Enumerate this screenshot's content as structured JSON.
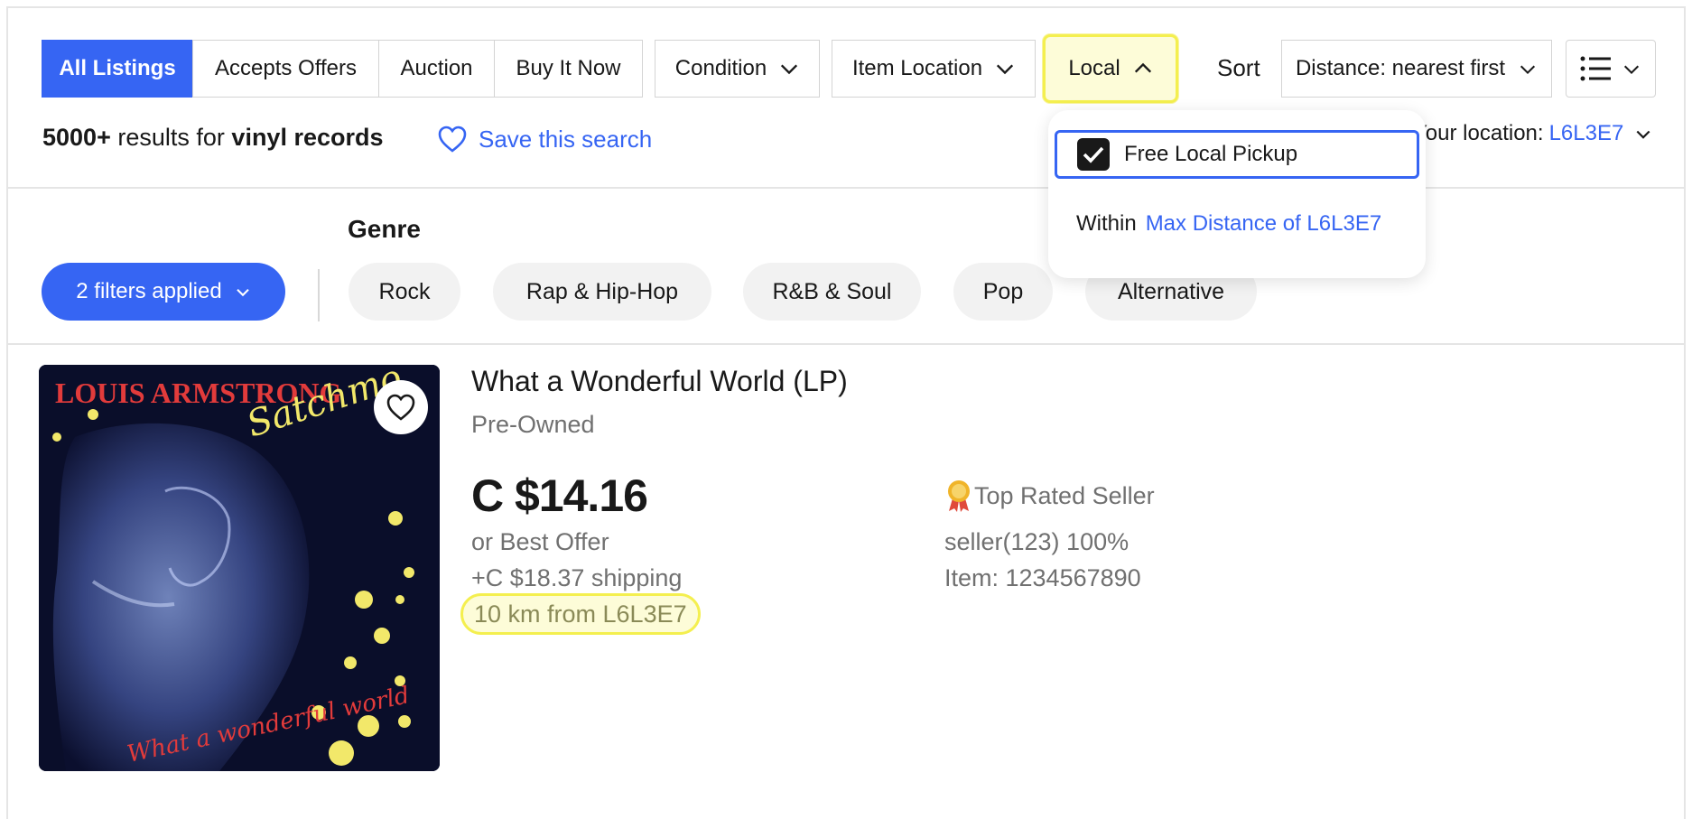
{
  "filter_bar": {
    "segments": [
      "All Listings",
      "Accepts Offers",
      "Auction",
      "Buy It Now"
    ],
    "condition_label": "Condition",
    "item_location_label": "Item Location",
    "local_label": "Local",
    "sort_label": "Sort",
    "sort_value": "Distance: nearest first"
  },
  "results": {
    "count": "5000+",
    "connector": "results for",
    "query": "vinyl records",
    "save_search_label": "Save this search",
    "your_location_label": "Your location:",
    "your_location_code": "L6L3E7"
  },
  "local_dropdown": {
    "pickup_label": "Free Local Pickup",
    "pickup_checked": true,
    "within_label": "Within",
    "max_distance_label": "Max Distance of L6L3E7"
  },
  "genre": {
    "heading": "Genre",
    "filters_applied": "2 filters applied",
    "chips": [
      "Rock",
      "Rap & Hip-Hop",
      "R&B & Soul",
      "Pop",
      "Alternative"
    ]
  },
  "listing": {
    "album_artist_text": "LOUIS ARMSTRONG",
    "album_script_text": "Satchmo",
    "album_bottom_text": "What a wonderful world",
    "title": "What a Wonderful World (LP)",
    "condition": "Pre-Owned",
    "price": "C $14.16",
    "best_offer": "or Best Offer",
    "shipping": "+C $18.37 shipping",
    "distance": "10 km from L6L3E7",
    "top_rated_label": "Top Rated Seller",
    "seller": "seller(123) 100%",
    "item_number": "Item: 1234567890"
  },
  "colors": {
    "accent": "#3665f3",
    "highlight_fill": "#fdfcd8",
    "highlight_border": "#f4ef4f"
  }
}
